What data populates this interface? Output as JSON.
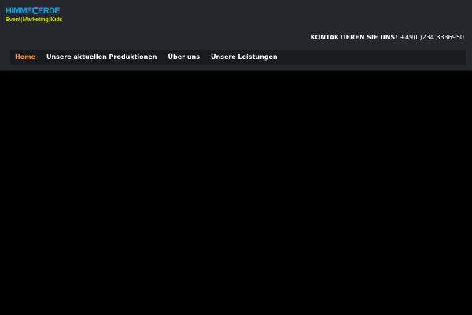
{
  "logo": {
    "top_left": "HIMMEL",
    "top_mid": [
      "UND",
      "MEHR"
    ],
    "top_right": "ERDE",
    "bottom": [
      "Event",
      "Marketing",
      "Kids"
    ],
    "separator": "|"
  },
  "contact": {
    "label": "KONTAKTIEREN SIE UNS!",
    "phone": "+49(0)234 3336950"
  },
  "nav": {
    "items": [
      {
        "label": "Home"
      },
      {
        "label": "Unsere aktuellen Produktionen"
      },
      {
        "label": "Über uns"
      },
      {
        "label": "Unsere Leistungen"
      }
    ]
  },
  "colors": {
    "header_bg": "#24272b",
    "nav_bg": "#191b1e",
    "accent_active": "#f08c3c",
    "logo_blue": "#1aa0e0",
    "logo_green": "#c8d400",
    "page_bg": "#000000"
  }
}
